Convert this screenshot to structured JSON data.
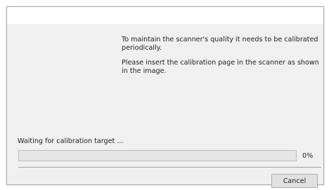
{
  "dialog": {
    "instructions": [
      "To maintain the scanner's quality it needs to be calibrated periodically.",
      "Please insert the calibration page in the scanner as shown in the image."
    ],
    "status_text": "Waiting for calibration target ...",
    "progress": {
      "value": 0,
      "label": "0%"
    },
    "buttons": {
      "cancel_label": "Cancel"
    }
  },
  "colors": {
    "client_background": "#f0f0f0",
    "titlebar_background": "#ffffff",
    "progress_track": "#e6e6e6",
    "button_face": "#e1e1e1"
  }
}
